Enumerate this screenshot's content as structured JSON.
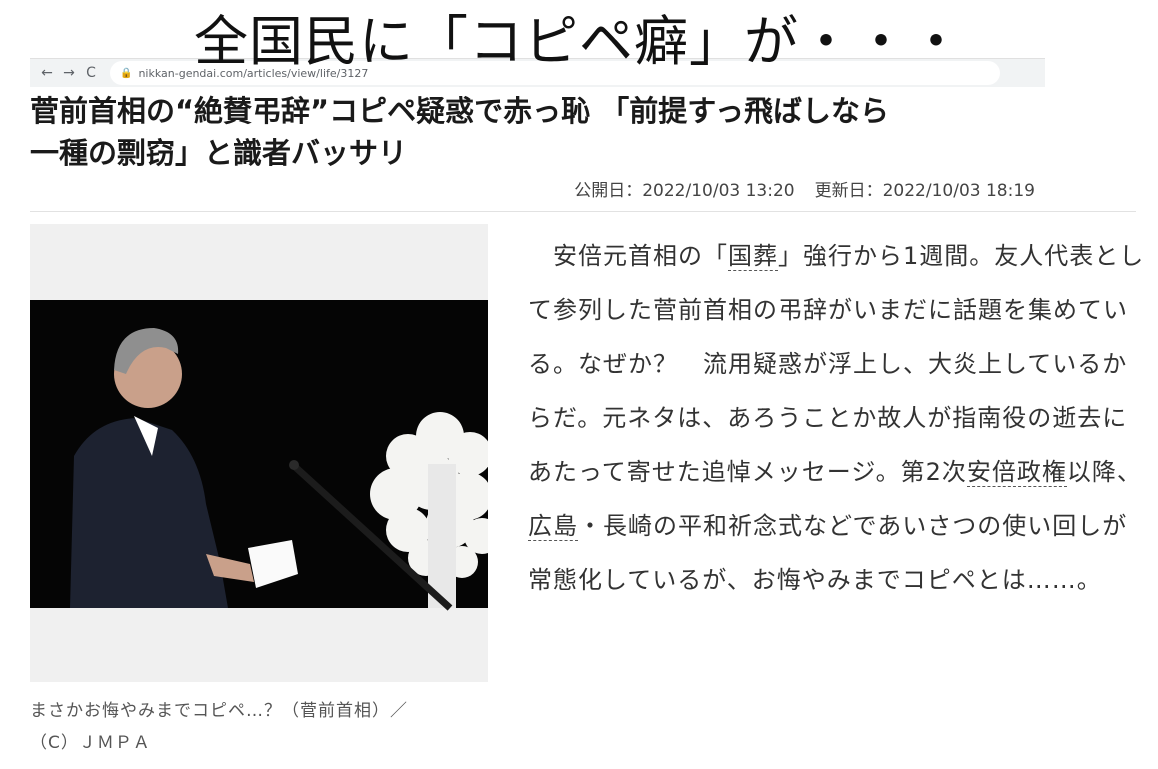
{
  "browser": {
    "back_icon": "←",
    "forward_icon": "→",
    "reload_icon": "C",
    "lock_icon": "🔒",
    "url": "nikkan-gendai.com/articles/view/life/3127"
  },
  "overlay_title": "全国民に「コピペ癖」が・・・",
  "article": {
    "headline_line1": "菅前首相の“絶賛弔辞”コピペ疑惑で赤っ恥 「前提すっ飛ばしなら",
    "headline_line2": "一種の剽窃」と識者バッサリ",
    "published": "公開日：2022/10/03 13:20",
    "updated": "更新日：2022/10/03 18:19",
    "caption_line1": "まさかお悔やみまでコピペ…？（菅前首相）／",
    "caption_line2": "（C）ＪＭＰＡ",
    "body": {
      "p1a": "　安倍元首相の「",
      "link1": "国葬",
      "p1b": "」強行から1週間。友人代表として参列した菅前首相の弔辞がいまだに話題を集めている。なぜか？　流用疑惑が浮上し、大炎上しているからだ。元ネタは、あろうことか故人が指南役の逝去にあたって寄せた追悼メッセージ。第2次",
      "link2": "安倍政権",
      "p1c": "以降、",
      "link3": "広島",
      "p1d": "・長崎の平和祈念式などであいさつの使い回しが常態化しているが、お悔やみまでコピペとは……。"
    }
  }
}
